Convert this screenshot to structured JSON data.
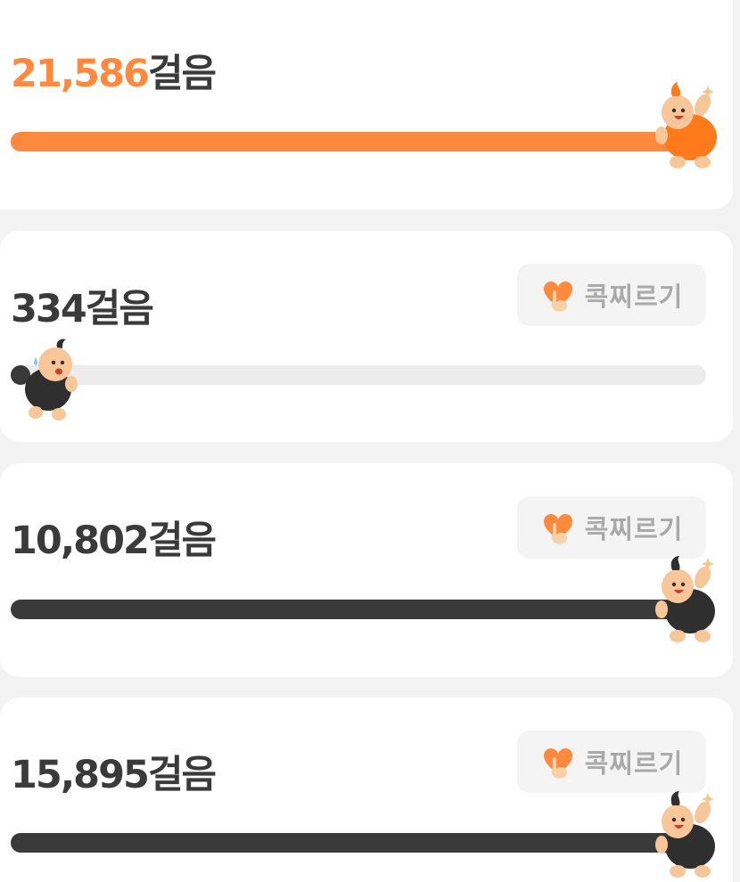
{
  "colors": {
    "accent": "#ff8a3d",
    "others_bar": "#3a3a3a",
    "track": "#ececec",
    "poke_text": "#a9a9a9"
  },
  "rows": [
    {
      "steps_value": "21,586",
      "steps_unit": "걸음",
      "is_me": true,
      "progress": 1.0,
      "mascot_color": "orange",
      "poke_label": ""
    },
    {
      "steps_value": "334",
      "steps_unit": "걸음",
      "is_me": false,
      "progress": 0.02,
      "mascot_color": "black",
      "poke_label": "콕찌르기",
      "poke_icon": "poke-hand-icon"
    },
    {
      "steps_value": "10,802",
      "steps_unit": "걸음",
      "is_me": false,
      "progress": 1.0,
      "mascot_color": "black",
      "poke_label": "콕찌르기",
      "poke_icon": "poke-hand-icon"
    },
    {
      "steps_value": "15,895",
      "steps_unit": "걸음",
      "is_me": false,
      "progress": 1.0,
      "mascot_color": "black",
      "poke_label": "콕찌르기",
      "poke_icon": "poke-hand-icon"
    }
  ]
}
